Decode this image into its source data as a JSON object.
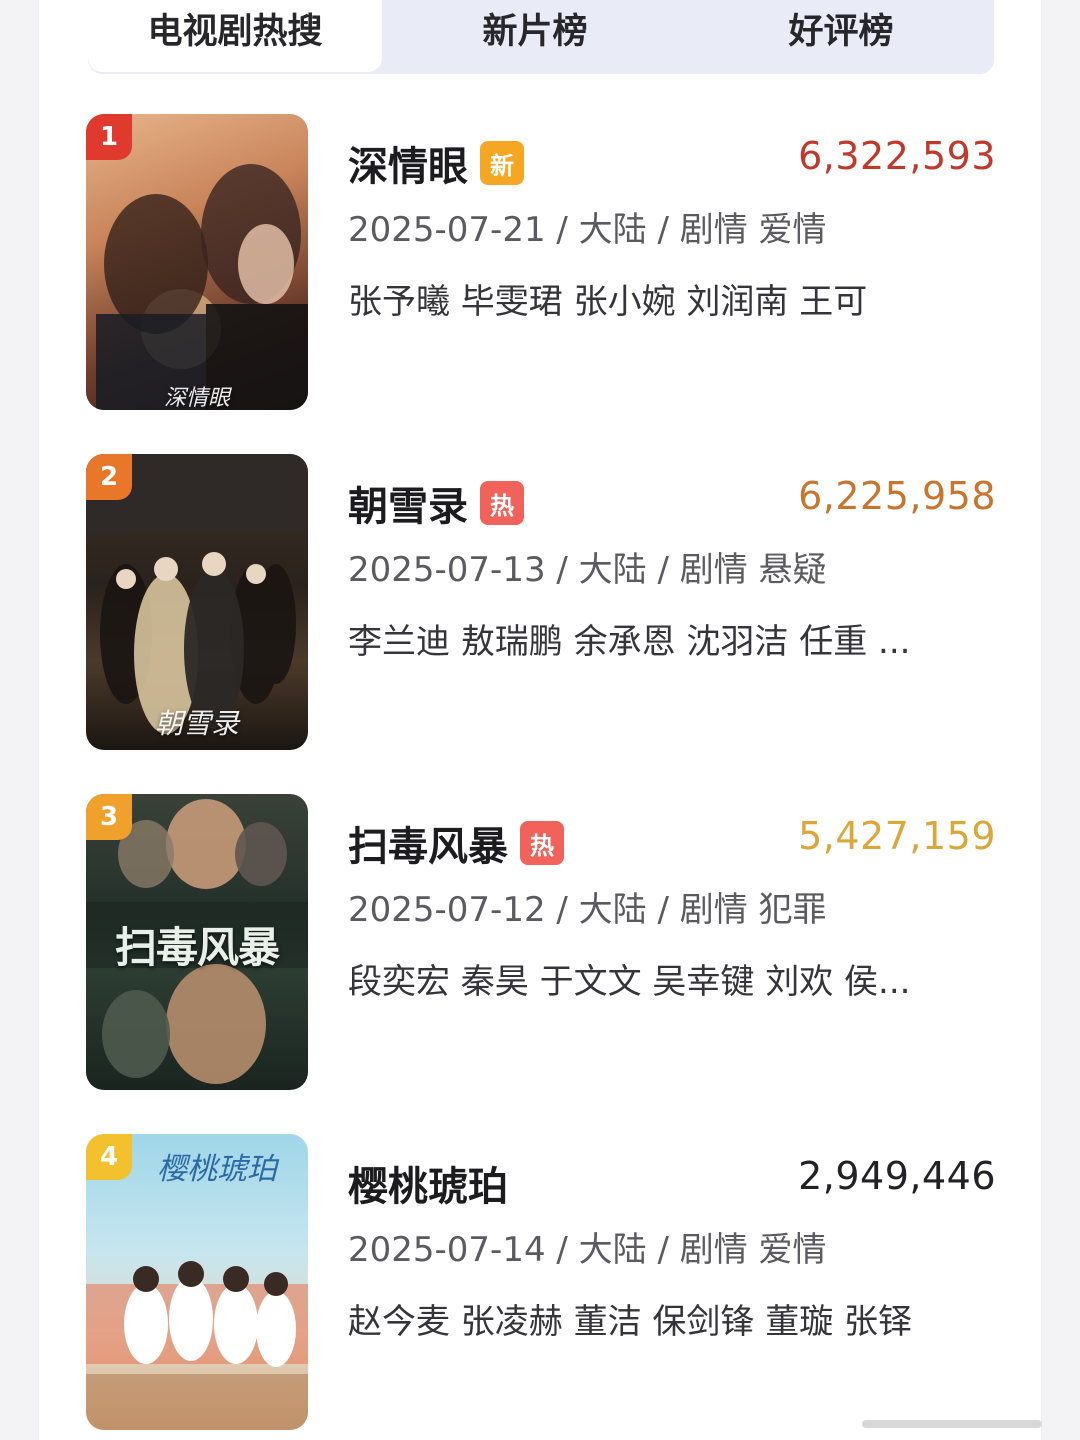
{
  "tabs": [
    {
      "label": "电视剧热搜",
      "active": true
    },
    {
      "label": "新片榜",
      "active": false
    },
    {
      "label": "好评榜",
      "active": false
    }
  ],
  "items": [
    {
      "rank": "1",
      "title": "深情眼",
      "tag": "新",
      "tag_color": "#f5a623",
      "heat": "6,322,593",
      "heat_color": "#c0392b",
      "meta": "2025-07-21 / 大陆 / 剧情 爱情",
      "cast": "张予曦 毕雯珺 张小婉 刘润南 王可",
      "poster_caption": "深情眼",
      "badge_color": "#e03a2f"
    },
    {
      "rank": "2",
      "title": "朝雪录",
      "tag": "热",
      "tag_color": "#f0625a",
      "heat": "6,225,958",
      "heat_color": "#c8762e",
      "meta": "2025-07-13 / 大陆 / 剧情 悬疑",
      "cast": "李兰迪 敖瑞鹏 余承恩 沈羽洁 任重 ...",
      "poster_caption": "朝雪录",
      "badge_color": "#e9772a"
    },
    {
      "rank": "3",
      "title": "扫毒风暴",
      "tag": "热",
      "tag_color": "#f0625a",
      "heat": "5,427,159",
      "heat_color": "#d9a73a",
      "meta": "2025-07-12 / 大陆 / 剧情 犯罪",
      "cast": "段奕宏 秦昊 于文文 吴幸键 刘欢 侯...",
      "poster_caption": "扫毒风暴",
      "badge_color": "#f0a12b"
    },
    {
      "rank": "4",
      "title": "樱桃琥珀",
      "tag": "",
      "tag_color": "",
      "heat": "2,949,446",
      "heat_color": "#222226",
      "meta": "2025-07-14 / 大陆 / 剧情 爱情",
      "cast": "赵今麦 张凌赫 董洁 保剑锋 董璇 张铎",
      "poster_caption": "樱桃琥珀",
      "badge_color": "#f3c12e"
    }
  ]
}
